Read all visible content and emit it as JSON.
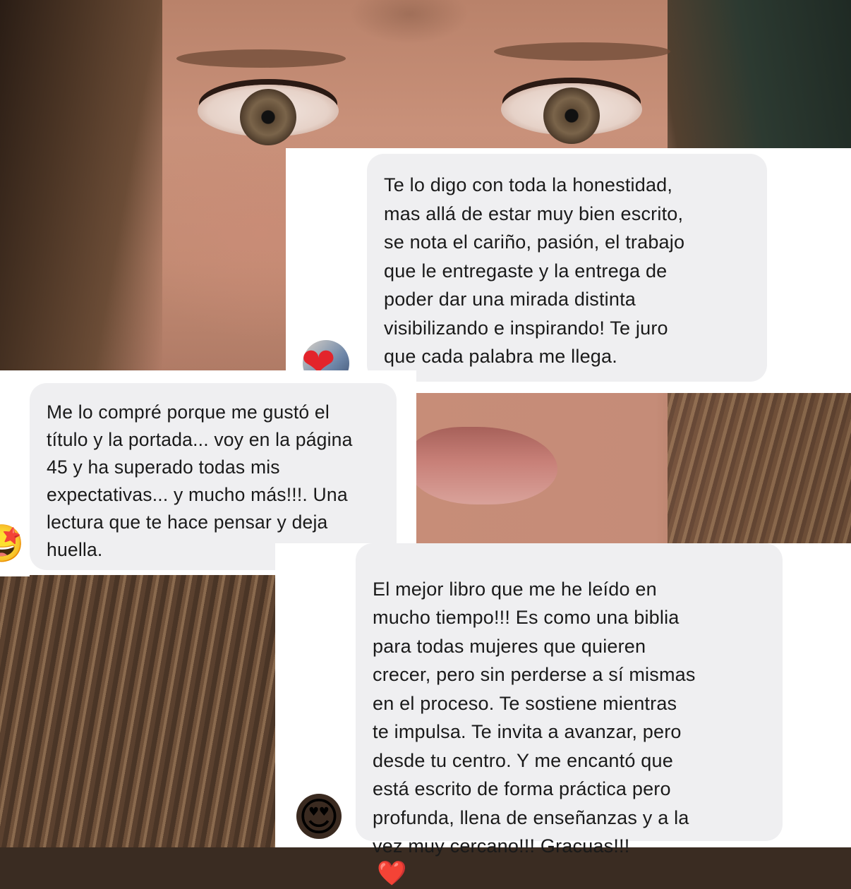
{
  "messages": [
    {
      "text": "Te lo digo con toda la honestidad,\nmas allá de estar muy bien escrito,\nse nota el cariño, pasión, el trabajo\nque le entregaste y la entrega de\npoder dar una mirada distinta\nvisibilizando e inspirando! Te juro\nque cada palabra me llega.",
      "reaction": "❤"
    },
    {
      "text": "Me lo compré porque me gustó el\ntítulo y la portada... voy en la página\n45 y ha superado todas mis\nexpectativas... y mucho más!!!. Una\nlectura que te hace pensar y deja\nhuella.",
      "avatar_emoji": "🤩"
    },
    {
      "text": "El mejor libro que me he leído en\nmucho tiempo!!! Es como una biblia\npara todas mujeres que quieren\ncrecer, pero sin perderse a sí mismas\nen el proceso. Te sostiene mientras\nte impulsa. Te invita a avanzar, pero\ndesde tu centro. Y me encantó que\nestá escrito de forma práctica pero\nprofunda, llena de enseñanzas y a la\nvez muy cercano!!! Gracuas!!!",
      "trailing_emoji": "❤️",
      "avatar_emoji": "😍"
    }
  ],
  "colors": {
    "bubble": "#efeff1",
    "text": "#1a1a1a",
    "heart": "#e3242b"
  }
}
